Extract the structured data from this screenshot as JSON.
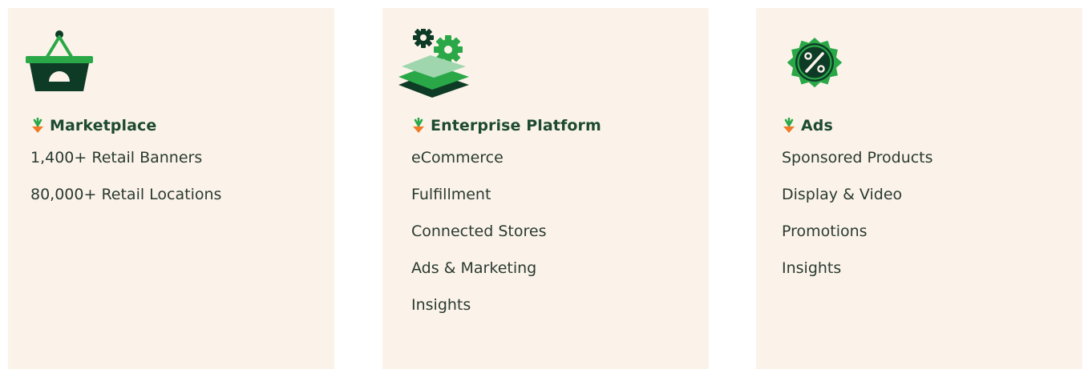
{
  "cards": [
    {
      "title": "Marketplace",
      "icon": "shopping-basket-icon",
      "items": [
        "1,400+ Retail Banners",
        "80,000+ Retail Locations"
      ]
    },
    {
      "title": "Enterprise Platform",
      "icon": "gears-layers-icon",
      "items": [
        "eCommerce",
        "Fulfillment",
        "Connected Stores",
        "Ads & Marketing",
        "Insights"
      ]
    },
    {
      "title": "Ads",
      "icon": "percent-badge-icon",
      "items": [
        "Sponsored Products",
        "Display & Video",
        "Promotions",
        "Insights"
      ]
    }
  ],
  "colors": {
    "card_background": "#fbf3ea",
    "dark_green": "#0d3b26",
    "bright_green": "#2aa847",
    "light_green": "#9fd6ae",
    "carrot_orange": "#f07a26",
    "title_text": "#1e4a32",
    "body_text": "#2a3a30"
  }
}
